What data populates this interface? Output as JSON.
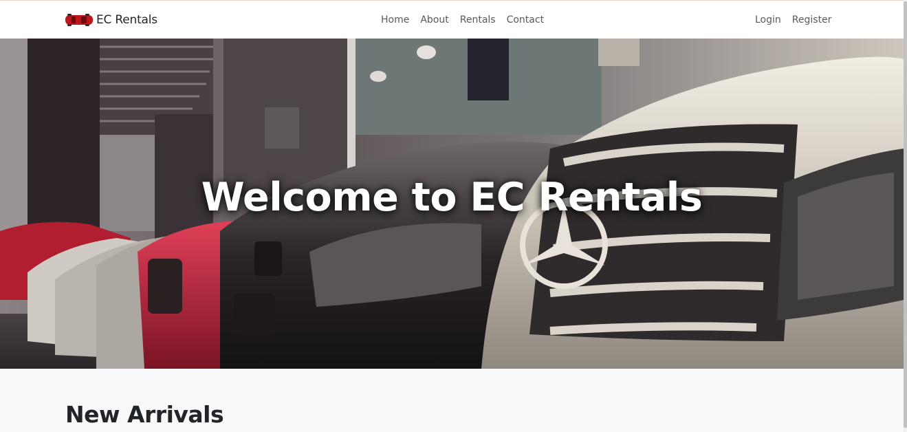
{
  "brand": {
    "name": "EC Rentals",
    "logo_icon": "red-car-icon",
    "logo_color": "#c0151b"
  },
  "nav": {
    "center_links": [
      {
        "label": "Home"
      },
      {
        "label": "About"
      },
      {
        "label": "Rentals"
      },
      {
        "label": "Contact"
      }
    ],
    "right_links": [
      {
        "label": "Login"
      },
      {
        "label": "Register"
      }
    ]
  },
  "hero": {
    "title": "Welcome to EC Rentals",
    "image": "row-of-cars-at-dealership-photo"
  },
  "sections": {
    "new_arrivals_title": "New Arrivals"
  },
  "colors": {
    "navbar_bg": "#ffffff",
    "page_bg": "#f8f9fa",
    "nav_text": "#595959",
    "heading_text": "#212529"
  }
}
